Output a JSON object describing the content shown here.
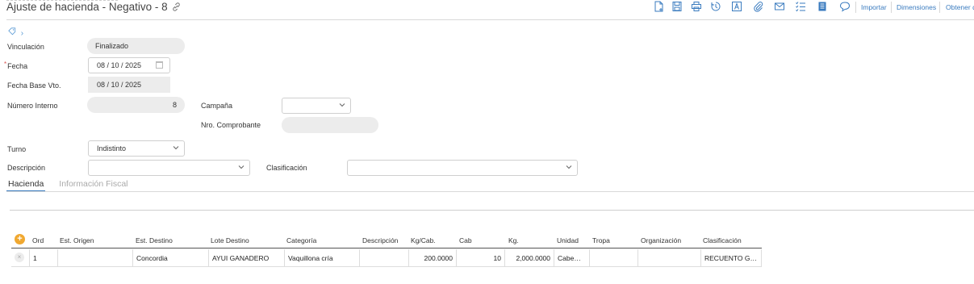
{
  "header": {
    "title": "Ajuste de hacienda - Negativo - 8",
    "link_icon": "link-icon",
    "toolbar_icons": [
      "new-document-icon",
      "save-icon",
      "print-icon",
      "history-icon",
      "text-icon",
      "attach-icon",
      "email-icon",
      "checklist-icon",
      "notes-icon",
      "comment-icon"
    ],
    "toolbar_links": [
      "Importar",
      "Dimensiones",
      "Obtener d"
    ]
  },
  "form": {
    "vinculacion": {
      "label": "Vinculación",
      "value": "Finalizado"
    },
    "fecha": {
      "label": "Fecha",
      "value": "08 / 10 / 2025",
      "required_mark": "*"
    },
    "fecha_base": {
      "label": "Fecha Base Vto.",
      "value": "08 / 10 / 2025"
    },
    "numero_interno": {
      "label": "Número Interno",
      "value": "8"
    },
    "campana": {
      "label": "Campaña",
      "value": ""
    },
    "nro_comprobante": {
      "label": "Nro. Comprobante",
      "value": ""
    },
    "turno": {
      "label": "Turno",
      "value": "Indistinto"
    },
    "descripcion": {
      "label": "Descripción",
      "value": ""
    },
    "clasificacion": {
      "label": "Clasificación",
      "value": ""
    }
  },
  "tabs": [
    {
      "label": "Hacienda",
      "active": true
    },
    {
      "label": "Información Fiscal",
      "active": false
    }
  ],
  "grid": {
    "columns": [
      "Ord",
      "Est. Origen",
      "Est. Destino",
      "Lote Destino",
      "Categoría",
      "Descripción",
      "Kg/Cab.",
      "Cab",
      "Kg.",
      "Unidad",
      "Tropa",
      "Organización",
      "Clasificación"
    ],
    "rows": [
      {
        "ord": "1",
        "est_origen": "",
        "est_destino": "Concordia",
        "lote_destino": "AYUI GANADERO",
        "categoria": "Vaquillona cría",
        "descripcion": "",
        "kg_cab": "200.0000",
        "cab": "10",
        "kg": "2,000.0000",
        "unidad": "Cabe…",
        "tropa": "",
        "organizacion": "",
        "clasificacion": "RECUENTO G…"
      }
    ]
  },
  "colors": {
    "accent": "#3a7bbf",
    "add": "#f0a830",
    "required": "#d9534f"
  }
}
